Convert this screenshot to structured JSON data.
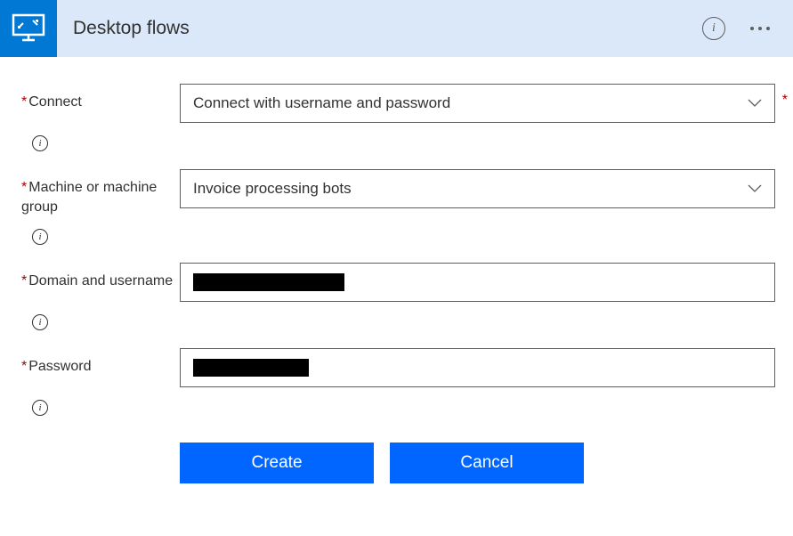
{
  "header": {
    "title": "Desktop flows"
  },
  "form": {
    "connect": {
      "label": "Connect",
      "value": "Connect with username and password"
    },
    "machine": {
      "label": "Machine or machine group",
      "value": "Invoice processing bots"
    },
    "domain": {
      "label": "Domain and username",
      "value": ""
    },
    "password": {
      "label": "Password",
      "value": ""
    }
  },
  "buttons": {
    "create": "Create",
    "cancel": "Cancel"
  }
}
